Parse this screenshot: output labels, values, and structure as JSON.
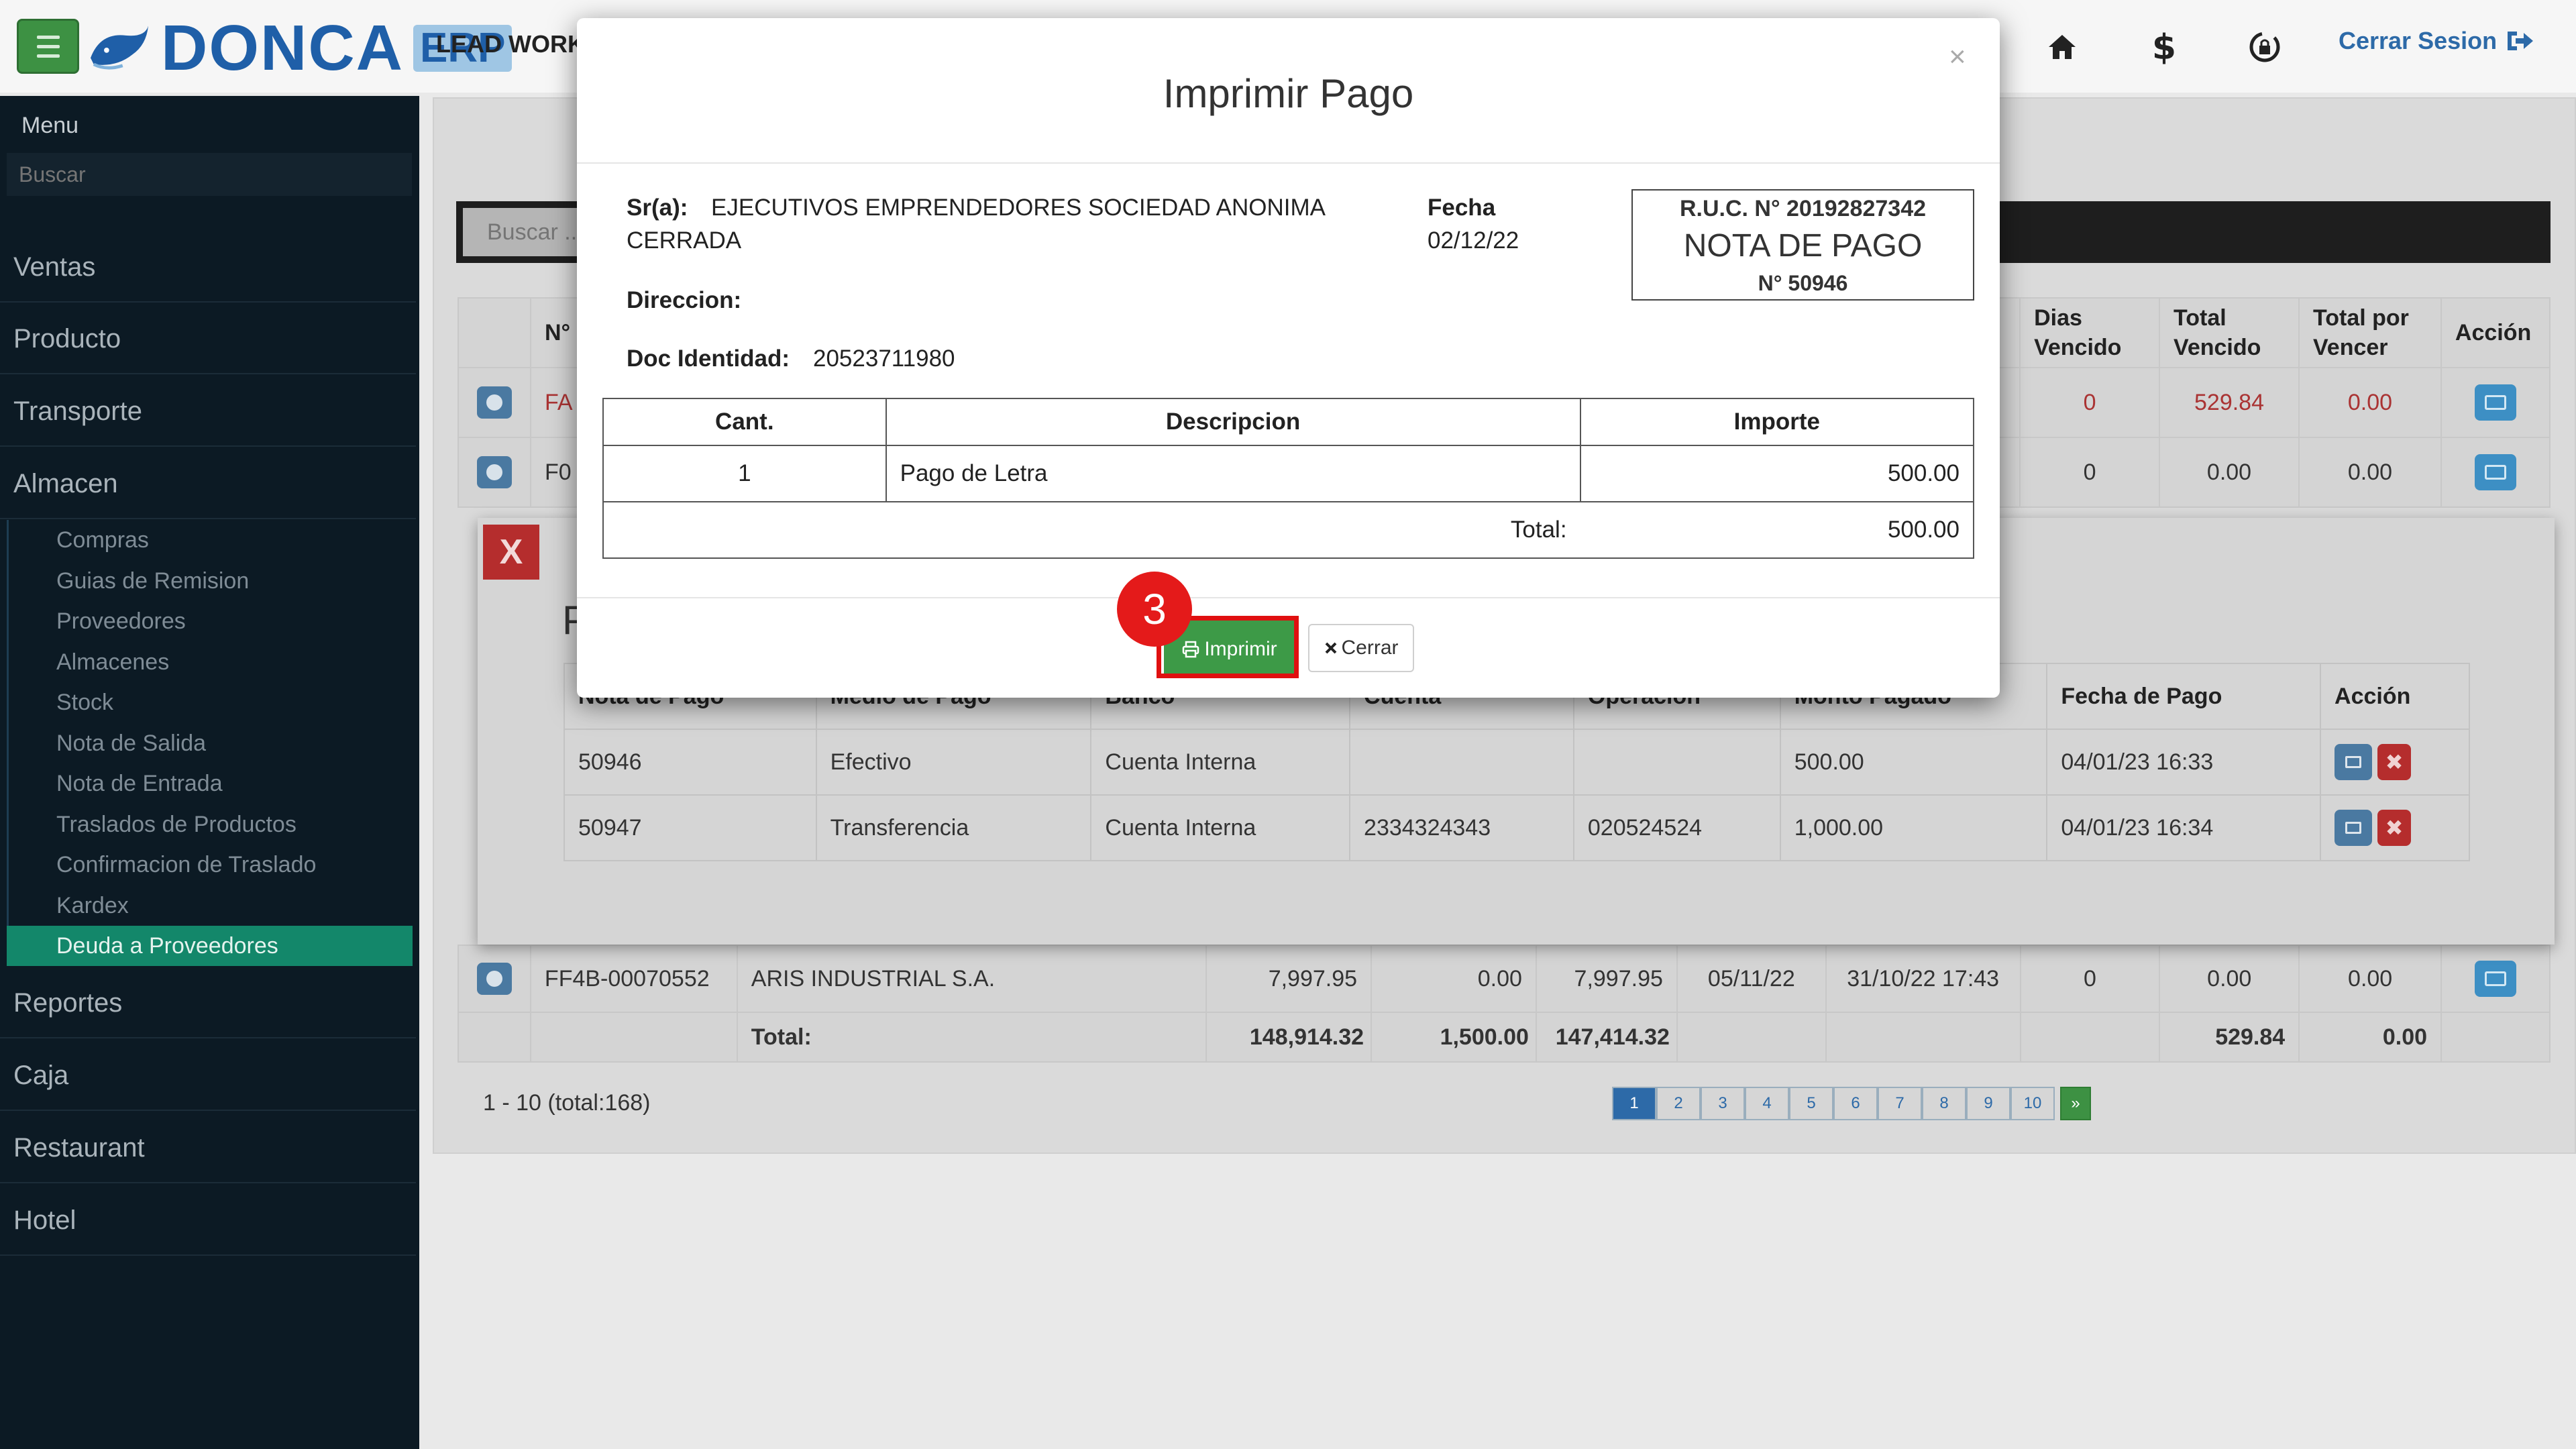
{
  "header": {
    "brand": "DONCA",
    "brand_suffix": "ERP",
    "lead_text": "LEAD WORK",
    "logout_label": "Cerrar Sesion"
  },
  "sidebar": {
    "title": "Menu",
    "search_placeholder": "Buscar",
    "items": [
      {
        "label": "Ventas"
      },
      {
        "label": "Producto"
      },
      {
        "label": "Transporte"
      },
      {
        "label": "Almacen"
      }
    ],
    "almacen_sub": [
      {
        "label": "Compras"
      },
      {
        "label": "Guias de Remision"
      },
      {
        "label": "Proveedores"
      },
      {
        "label": "Almacenes"
      },
      {
        "label": "Stock"
      },
      {
        "label": "Nota de Salida"
      },
      {
        "label": "Nota de Entrada"
      },
      {
        "label": "Traslados de Productos"
      },
      {
        "label": "Confirmacion de Traslado"
      },
      {
        "label": "Kardex"
      },
      {
        "label": "Deuda a Proveedores"
      }
    ],
    "items_after": [
      {
        "label": "Reportes"
      },
      {
        "label": "Caja"
      },
      {
        "label": "Restaurant"
      },
      {
        "label": "Hotel"
      }
    ]
  },
  "main": {
    "search_placeholder": "Buscar ...",
    "columns": {
      "n": "N°",
      "dias_vencido": "Dias Vencido",
      "total_vencido": "Total Vencido",
      "total_por_vencer": "Total por Vencer",
      "accion": "Acción"
    },
    "rows": [
      {
        "doc": "FA",
        "dias": "0",
        "tv": "529.84",
        "tpv": "0.00"
      },
      {
        "doc": "F0",
        "dias": "0",
        "tv": "0.00",
        "tpv": "0.00"
      }
    ],
    "last_row": {
      "doc": "FF4B-00070552",
      "proveedor": "ARIS INDUSTRIAL S.A.",
      "c1": "7,997.95",
      "c2": "0.00",
      "c3": "7,997.95",
      "c4": "05/11/22",
      "c5": "31/10/22 17:43",
      "dias": "0",
      "tv": "0.00",
      "tpv": "0.00"
    },
    "totals": {
      "label": "Total:",
      "c1": "148,914.32",
      "c2": "1,500.00",
      "c3": "147,414.32",
      "tv": "529.84",
      "tpv": "0.00"
    },
    "range_info": "1 - 10 (total:168)",
    "pages": [
      "1",
      "2",
      "3",
      "4",
      "5",
      "6",
      "7",
      "8",
      "9",
      "10"
    ],
    "next_label": "»"
  },
  "payments": {
    "close_label": "X",
    "heading": "P",
    "columns": [
      "Nota de Pago",
      "Medio de Pago",
      "Banco",
      "Cuenta",
      "Operacion",
      "Monto Pagado",
      "Fecha de Pago",
      "Acción"
    ],
    "rows": [
      {
        "nota": "50946",
        "medio": "Efectivo",
        "banco": "Cuenta Interna",
        "cuenta": "",
        "operacion": "",
        "monto": "500.00",
        "fecha": "04/01/23 16:33"
      },
      {
        "nota": "50947",
        "medio": "Transferencia",
        "banco": "Cuenta Interna",
        "cuenta": "2334324343",
        "operacion": "020524524",
        "monto": "1,000.00",
        "fecha": "04/01/23 16:34"
      }
    ],
    "delete_glyph": "✖"
  },
  "modal": {
    "title": "Imprimir Pago",
    "close_glyph": "×",
    "client_label": "Sr(a):",
    "client_name_l1": "EJECUTIVOS EMPRENDEDORES SOCIEDAD ANONIMA",
    "client_name_l2": "CERRADA",
    "fecha_label": "Fecha",
    "fecha_value": "02/12/22",
    "direccion_label": "Direccion:",
    "doc_label": "Doc Identidad:",
    "doc_value": "20523711980",
    "ruc_line": "R.U.C. N° 20192827342",
    "nota_title": "NOTA DE PAGO",
    "nota_number": "N° 50946",
    "table": {
      "headers": [
        "Cant.",
        "Descripcion",
        "Importe"
      ],
      "row": {
        "cant": "1",
        "desc": "Pago de Letra",
        "importe": "500.00"
      },
      "total_label": "Total:",
      "total_value": "500.00"
    },
    "print_label": "Imprimir",
    "close_label": "Cerrar",
    "step_number": "3"
  },
  "colors": {
    "brand_blue": "#1f5fa8",
    "green": "#3d9a47",
    "danger": "#b52d2d",
    "highlight": "#e01010",
    "sidebar_bg": "#0c1a24",
    "active_item": "#13876a"
  }
}
